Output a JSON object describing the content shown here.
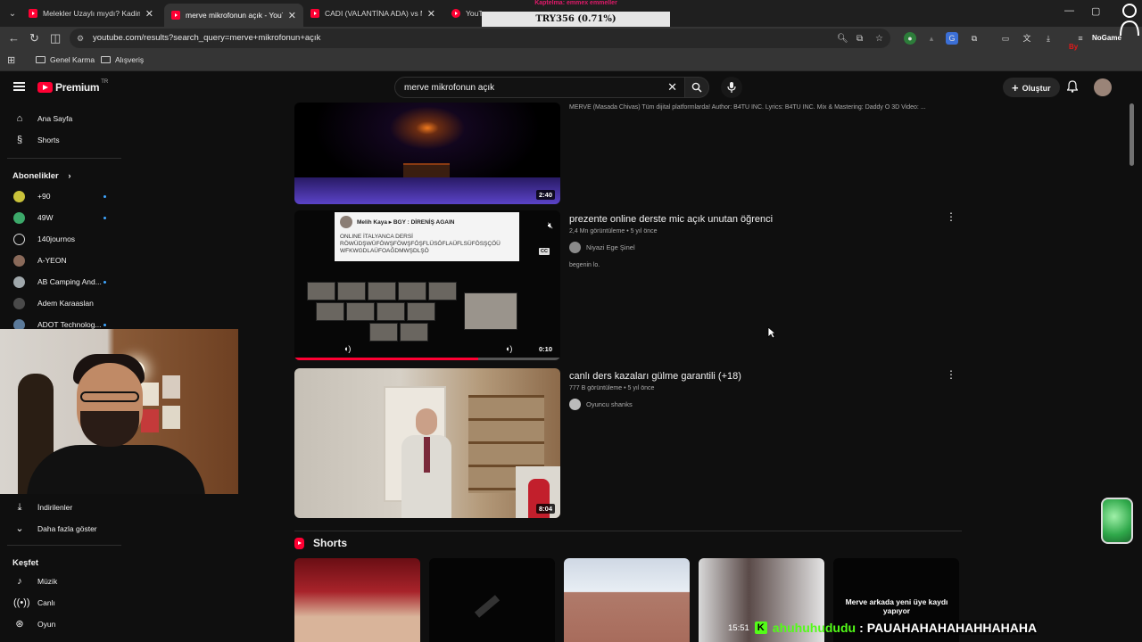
{
  "browser": {
    "tabs": [
      {
        "title": "Melekler Uzaylı mıydı? Kadim M"
      },
      {
        "title": "merve mikrofonun açık - YouTube"
      },
      {
        "title": "CADI (VALANTİNA ADA) vs MER"
      },
      {
        "title": "YouTube"
      }
    ],
    "url": "youtube.com/results?search_query=merve+mikrofonun+açık",
    "bookmarks": [
      "Genel Karma",
      "Alışveriş"
    ]
  },
  "youtube": {
    "logo_text": "Premium",
    "logo_country": "TR",
    "search_query": "merve mikrofonun açık",
    "create_label": "Oluştur"
  },
  "sidebar": {
    "home": "Ana Sayfa",
    "shorts": "Shorts",
    "subs_heading": "Abonelikler",
    "subs": [
      {
        "name": "+90",
        "color": "#c9c23a",
        "dot": true
      },
      {
        "name": "49W",
        "color": "#3ca96a",
        "dot": true
      },
      {
        "name": "140journos",
        "color": "#eeeeee",
        "dot": false
      },
      {
        "name": "A-YEON",
        "color": "#8a6a5a",
        "dot": false
      },
      {
        "name": "AB Camping And...",
        "color": "#a0a8ac",
        "dot": true
      },
      {
        "name": "Adem Karaaslan",
        "color": "#4a4a4a",
        "dot": false
      },
      {
        "name": "ADOT Technolog...",
        "color": "#5b7a9a",
        "dot": true
      }
    ],
    "downloads": "İndirilenler",
    "show_more": "Daha fazla göster",
    "explore_heading": "Keşfet",
    "explore": [
      "Müzik",
      "Canlı",
      "Oyun"
    ]
  },
  "results": [
    {
      "description": "MERVE (Masada Chivas) Tüm dijital platformlarda! Author: B4TU INC. Lyrics: B4TU INC. Mix & Mastering: Daddy O 3D Video: ...",
      "duration": "2:40"
    },
    {
      "title": "prezente online derste mic açık unutan öğrenci",
      "meta": "2,4 Mn görüntüleme • 5 yıl önce",
      "channel": "Niyazi Ege Şinel",
      "description": "begenin lo.",
      "duration": "0:10",
      "progress": 0.69,
      "overlay_name": "Melih Kaya ▸ BGY : DİRENİŞ AGAIN",
      "overlay_text": "ONLINE İTALYANCA DERSİ RÖWÜDŞWÜFÖWŞFÖWŞFÖŞFLÜSÖFLAÜFLSÜFÖSŞÇÖÜ WFKWGDLAÜFOAĞDMWŞDLŞÖ",
      "cc": "CC"
    },
    {
      "title": "canlı ders kazaları gülme garantili (+18)",
      "meta": "777 B görüntüleme • 5 yıl önce",
      "channel": "Oyuncu shanks",
      "duration": "8:04"
    }
  ],
  "shorts": {
    "heading": "Shorts",
    "last_caption": "Merve arkada yeni üye kaydı yapıyor"
  },
  "overlays": {
    "donation_label": "Kaptelma: emmex emmeller",
    "donation_amount": "TRY356 (0.71%)",
    "chat_time": "15:51",
    "chat_user": "ahuhuhududu",
    "chat_sep": ":",
    "chat_message": "PAUAHAHAHAHAHHAHAHA",
    "badge_by": "By",
    "badge_game": "NoGame"
  }
}
